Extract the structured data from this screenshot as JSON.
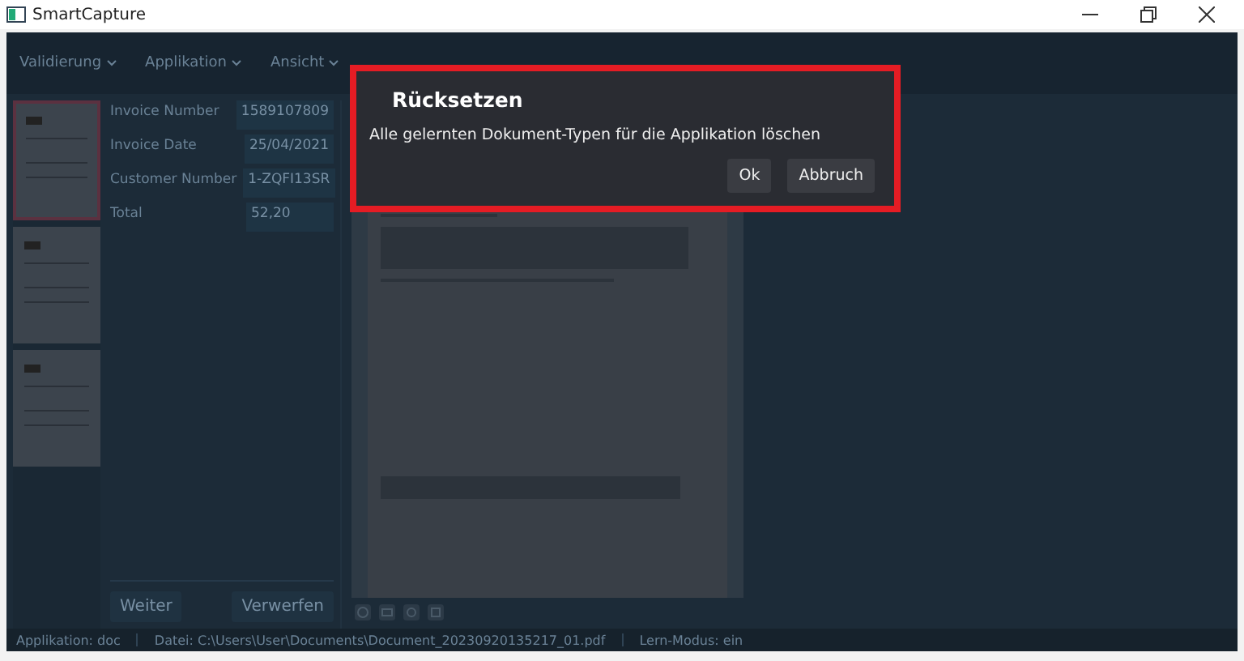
{
  "window": {
    "title": "SmartCapture"
  },
  "menu": [
    {
      "label": "Validierung"
    },
    {
      "label": "Applikation"
    },
    {
      "label": "Ansicht"
    }
  ],
  "thumbnails": [
    {
      "selected": true
    },
    {
      "selected": false
    },
    {
      "selected": false
    }
  ],
  "fields": [
    {
      "label": "Invoice Number",
      "value": "1589107809"
    },
    {
      "label": "Invoice Date",
      "value": "25/04/2021"
    },
    {
      "label": "Customer Number",
      "value": "1-ZQFI13SR"
    },
    {
      "label": "Total",
      "value": "52,20"
    }
  ],
  "actions": [
    "Weiter",
    "Verwerfen"
  ],
  "status_bar": [
    "Applikation: doc",
    "Datei: C:\\Users\\User\\Documents\\Document_20230920135217_01.pdf",
    "Lern-Modus: ein"
  ],
  "dialog": {
    "title": "Rücksetzen",
    "message": "Alle gelernten Dokument-Typen für die Applikation löschen",
    "buttons": [
      "Ok",
      "Abbruch"
    ]
  }
}
